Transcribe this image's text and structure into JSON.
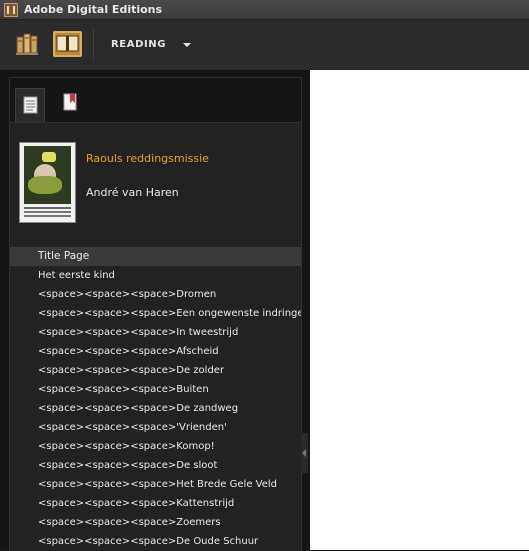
{
  "window": {
    "title": "Adobe Digital Editions",
    "icon": "ade-app-icon"
  },
  "toolbar": {
    "library_icon": "library-books-icon",
    "reading_icon": "open-book-icon",
    "view_label": "READING",
    "dropdown_icon": "chevron-down-icon"
  },
  "panel": {
    "tabs": [
      {
        "name": "table-of-contents",
        "icon": "toc-list-icon",
        "active": true
      },
      {
        "name": "bookmarks",
        "icon": "bookmark-icon",
        "active": false
      }
    ]
  },
  "book": {
    "title": "Raouls reddingsmissie",
    "author": "André van Haren",
    "cover_icon": "book-cover-thumbnail"
  },
  "toc": [
    "Title Page",
    "Het eerste kind",
    "<space><space><space>Dromen",
    "<space><space><space>Een ongewenste indringer",
    "<space><space><space>In tweestrijd",
    "<space><space><space>Afscheid",
    "<space><space><space>De zolder",
    "<space><space><space>Buiten",
    "<space><space><space>De zandweg",
    "<space><space><space>'Vrienden'",
    "<space><space><space>Komop!",
    "<space><space><space>De sloot",
    "<space><space><space>Het Brede Gele Veld",
    "<space><space><space>Kattenstrijd",
    "<space><space><space>Zoemers",
    "<space><space><space>De Oude Schuur"
  ],
  "colors": {
    "accent": "#e8a030",
    "toolbar_active": "#b88a3c",
    "panel_bg": "#222222",
    "reading_bg": "#ffffff"
  }
}
